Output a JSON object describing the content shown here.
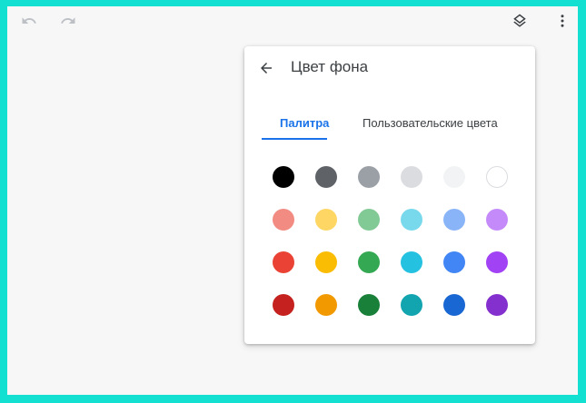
{
  "toolbar": {
    "undo_icon": "undo-icon",
    "redo_icon": "redo-icon",
    "layers_icon": "layers-icon",
    "more_icon": "more-vert-icon"
  },
  "panel": {
    "back_icon": "arrow-back-icon",
    "title": "Цвет фона",
    "tabs": [
      {
        "label": "Палитра",
        "active": true
      },
      {
        "label": "Пользовательские цвета",
        "active": false
      }
    ],
    "accent_color": "#1a73e8",
    "swatches": [
      "#000000",
      "#5f6368",
      "#9aa0a6",
      "#dadce0",
      "#f1f3f4",
      "#ffffff",
      "#f28b82",
      "#fdd663",
      "#81c995",
      "#78d9ec",
      "#8ab4f8",
      "#c58af9",
      "#ea4335",
      "#fbbc04",
      "#34a853",
      "#24c1e0",
      "#4285f4",
      "#a142f4",
      "#c5221f",
      "#f29900",
      "#188038",
      "#12a4af",
      "#1967d2",
      "#8430ce"
    ]
  }
}
